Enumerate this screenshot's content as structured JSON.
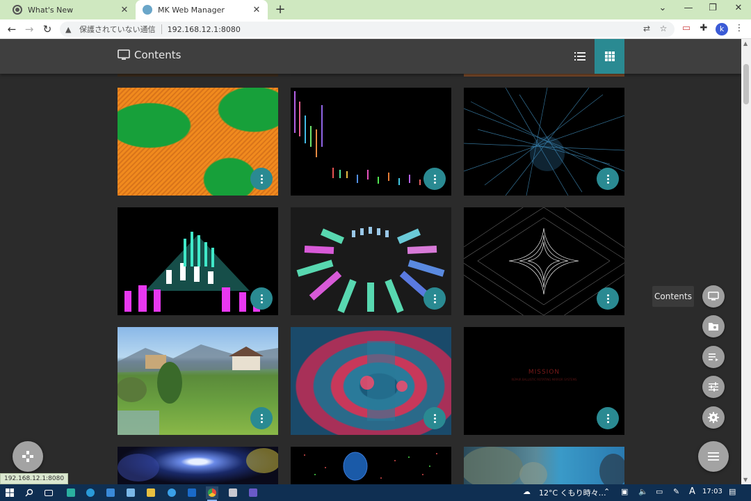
{
  "browser": {
    "tabs": [
      {
        "title": "What's New",
        "active": false
      },
      {
        "title": "MK Web Manager",
        "active": true
      }
    ],
    "new_tab": "+",
    "insecure_label": "保護されていない通信",
    "url": "192.168.12.1:8080",
    "profile_initial": "k"
  },
  "app": {
    "title": "Contents",
    "accent": "#2a8a92",
    "tooltip": "Contents",
    "status_url": "192.168.12.1:8080"
  },
  "grid_items": [
    {
      "name": "green-orange-flow"
    },
    {
      "name": "spectrum-bars"
    },
    {
      "name": "blue-lines"
    },
    {
      "name": "cyan-magenta-cubes"
    },
    {
      "name": "cube-ring"
    },
    {
      "name": "white-diamond"
    },
    {
      "name": "alpine-village"
    },
    {
      "name": "red-blue-tunnel"
    },
    {
      "name": "mission-text",
      "text": "MISSION",
      "subtext": "REPAIR BALLISTIC ROTATING MIRROR SYSTEMS"
    },
    {
      "name": "galaxy"
    },
    {
      "name": "blue-planet"
    },
    {
      "name": "underwater-reef"
    }
  ],
  "taskbar": {
    "weather": "12°C くもり時々…",
    "ime": "A",
    "time": "17:03"
  }
}
